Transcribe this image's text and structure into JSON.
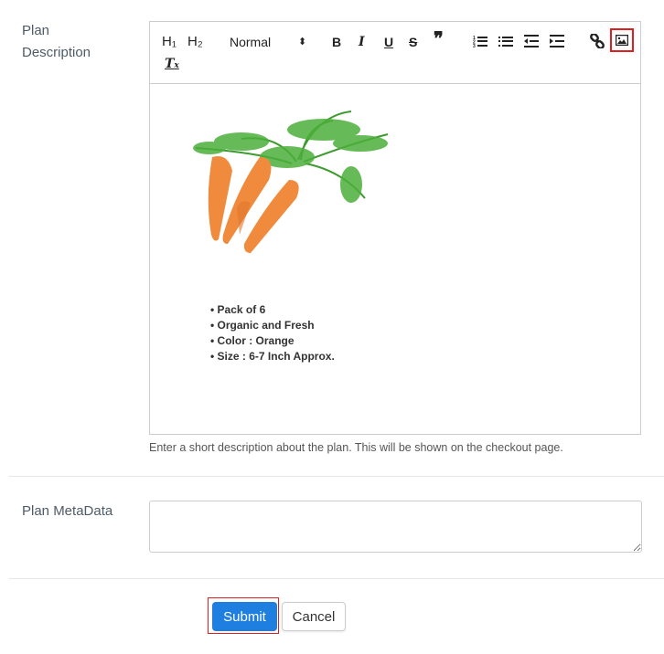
{
  "description": {
    "label_line1": "Plan",
    "label_line2": "Description",
    "help_text": "Enter a short description about the plan. This will be shown on the checkout page.",
    "toolbar": {
      "h1": "H₁",
      "h2": "H₂",
      "format_select": "Normal",
      "bold": "B",
      "italic": "I",
      "underline": "U",
      "strike": "S",
      "quote": "❞",
      "clear_format": "T"
    },
    "content": {
      "image_alt": "carrots-image",
      "bullets": [
        "Pack of 6",
        "Organic and Fresh",
        "Color : Orange",
        "Size : 6-7 Inch Approx."
      ]
    }
  },
  "metadata": {
    "label": "Plan MetaData",
    "value": ""
  },
  "actions": {
    "submit": "Submit",
    "cancel": "Cancel"
  },
  "colors": {
    "primary": "#1e7fe0",
    "highlight": "#e02020"
  }
}
